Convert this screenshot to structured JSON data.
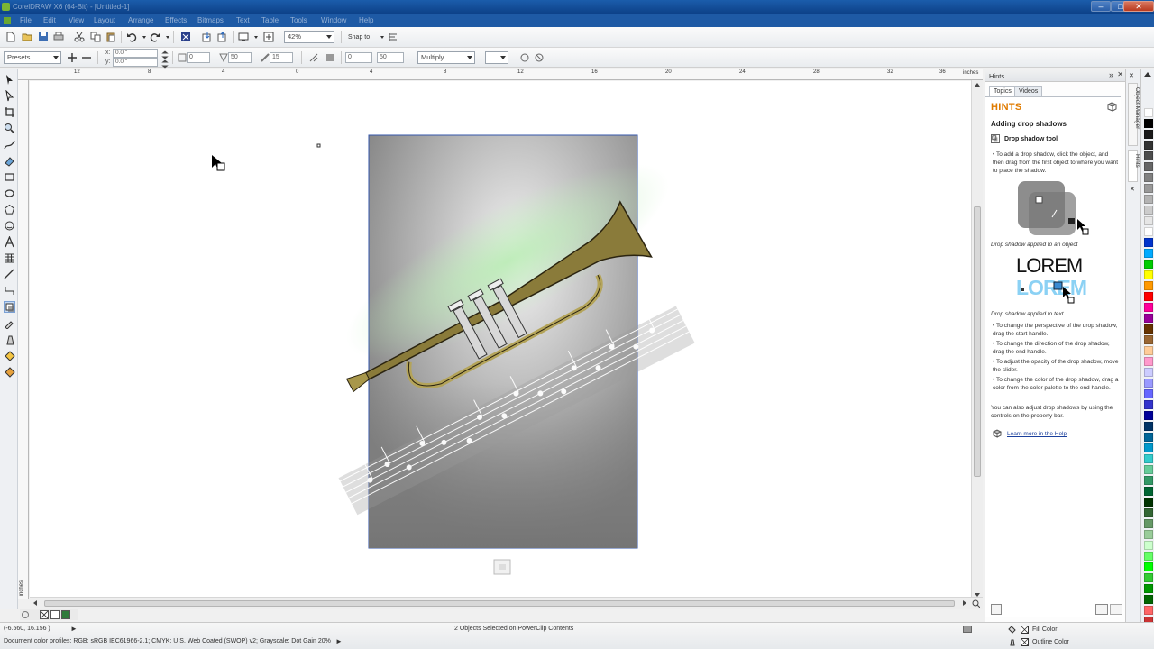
{
  "window": {
    "title": "CorelDRAW X6 (64-Bit) - [Untitled-1]",
    "minimize": "–",
    "maximize": "□",
    "close": "✕"
  },
  "menu": {
    "items": [
      "File",
      "Edit",
      "View",
      "Layout",
      "Arrange",
      "Effects",
      "Bitmaps",
      "Text",
      "Table",
      "Tools",
      "Window",
      "Help"
    ]
  },
  "toolbar": {
    "zoom_value": "42%",
    "snap_to_label": "Snap to"
  },
  "property_bar": {
    "presets_value": "Presets...",
    "x_value": "0.0 \"",
    "y_value": "0.0 \"",
    "x_label": "x:",
    "y_label": "y:",
    "offset_value": "0",
    "opacity_value": "50",
    "feather_value": "15",
    "stretch_value": "0",
    "fade_value": "50",
    "blend_mode_value": "Multiply"
  },
  "ruler": {
    "unit": "inches",
    "top_labels": [
      "12",
      "8",
      "4",
      "0",
      "4",
      "8",
      "12",
      "16",
      "20",
      "24",
      "28",
      "32",
      "36"
    ],
    "left_label": "inches"
  },
  "hints": {
    "panel_title": "Hints",
    "tab_topics": "Topics",
    "tab_videos": "Videos",
    "heading": "HINTS",
    "topic_title": "Adding drop shadows",
    "tool_name": "Drop shadow tool",
    "step1": "To add a drop shadow, click the object, and then drag from the first object to where you want to place the shadow.",
    "caption_object": "Drop shadow applied to an object",
    "sample_text": "LOREM",
    "caption_text": "Drop shadow applied to text",
    "bullets": [
      "To change the perspective of the drop shadow, drag the start handle.",
      "To change the direction of the drop shadow, drag the end handle.",
      "To adjust the opacity of the drop shadow, move the slider.",
      "To change the color of the drop shadow, drag a color from the color palette to the end handle."
    ],
    "note": "You can also adjust drop shadows by using the controls on the property bar.",
    "learn_more": "Learn more in the Help"
  },
  "side_tabs": [
    "Object Manager",
    "Hints"
  ],
  "palette": {
    "colors": [
      "#ffffff",
      "#000000",
      "#1a1a1a",
      "#333333",
      "#4d4d4d",
      "#666666",
      "#808080",
      "#999999",
      "#b3b3b3",
      "#cccccc",
      "#e6e6e6",
      "#ffffff",
      "#0033cc",
      "#00aaff",
      "#00cc00",
      "#ffff00",
      "#ff9900",
      "#ff0000",
      "#ff0099",
      "#990099",
      "#663300",
      "#996633",
      "#ffcc99",
      "#ff99cc",
      "#ccccff",
      "#9999ff",
      "#6666ff",
      "#3333cc",
      "#000099",
      "#003366",
      "#006699",
      "#0099cc",
      "#33cccc",
      "#66cc99",
      "#339966",
      "#006633",
      "#003300",
      "#336633",
      "#669966",
      "#99cc99",
      "#ccffcc",
      "#66ff66",
      "#00ff00",
      "#33cc33",
      "#009900",
      "#006600",
      "#ff6666",
      "#cc3333"
    ]
  },
  "status": {
    "coords": "(-6.560, 16.156 )",
    "selection": "2 Objects Selected on PowerClip Contents",
    "color_profiles": "Document color profiles: RGB: sRGB IEC61966-2.1; CMYK: U.S. Web Coated (SWOP) v2; Grayscale: Dot Gain 20%",
    "fill_label": "Fill Color",
    "outline_label": "Outline Color"
  },
  "colors": {
    "titlebar": "#0c3f86",
    "accent_orange": "#e07b00",
    "link_blue": "#1a3f9c"
  }
}
